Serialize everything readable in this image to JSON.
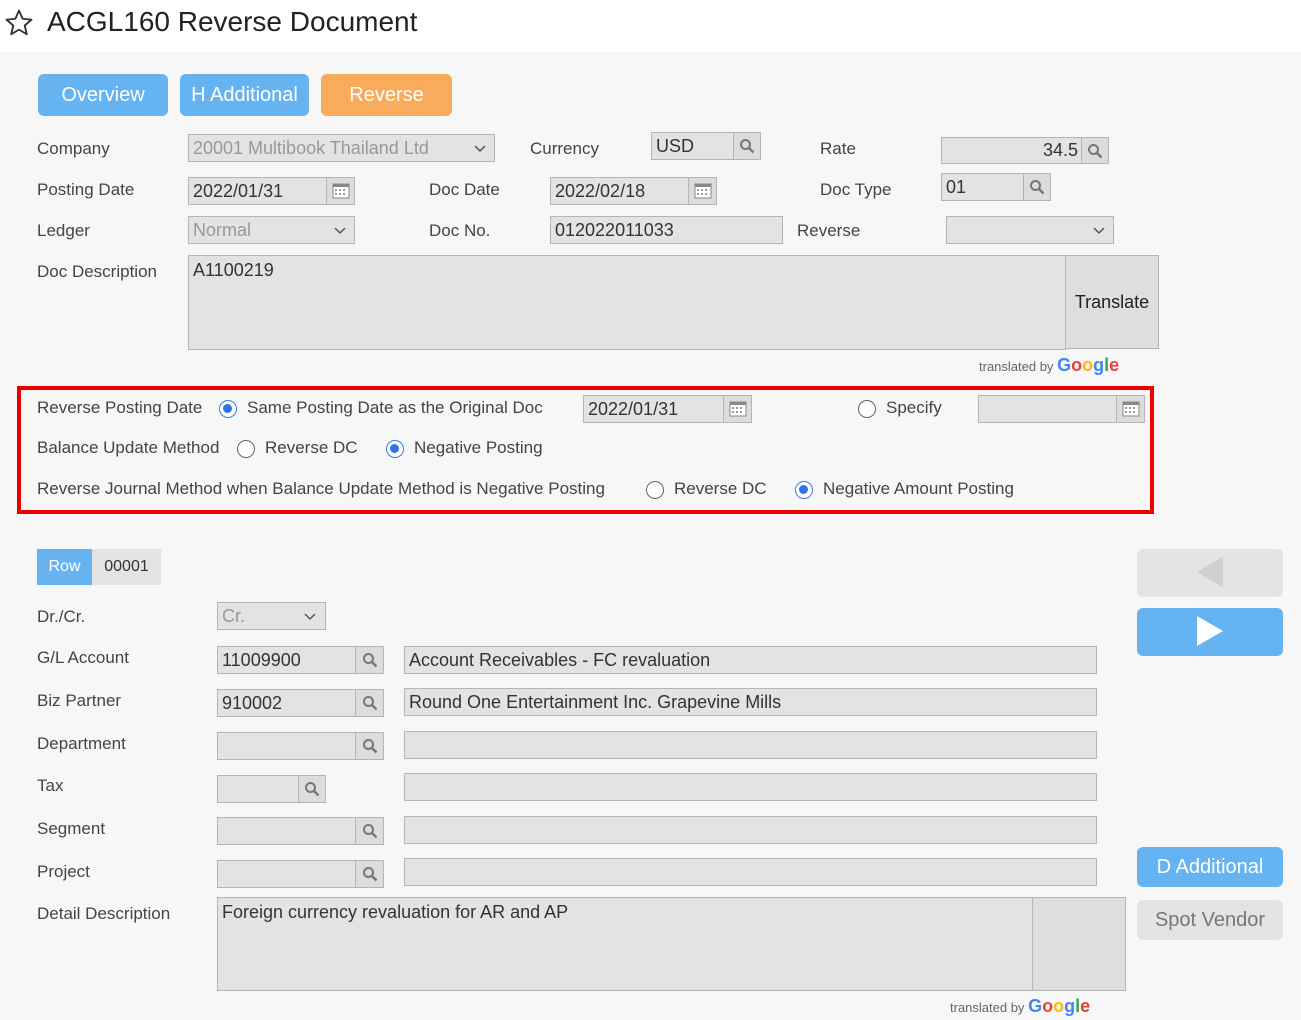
{
  "header": {
    "title": "ACGL160 Reverse Document",
    "icon": "star-icon"
  },
  "tabs": {
    "overview": "Overview",
    "h_additional": "H Additional",
    "reverse": "Reverse"
  },
  "doc": {
    "company_label": "Company",
    "company_value": "20001 Multibook Thailand Ltd",
    "currency_label": "Currency",
    "currency_value": "USD",
    "rate_label": "Rate",
    "rate_value": "34.5",
    "posting_date_label": "Posting Date",
    "posting_date_value": "2022/01/31",
    "doc_date_label": "Doc Date",
    "doc_date_value": "2022/02/18",
    "doc_type_label": "Doc Type",
    "doc_type_value": "01",
    "ledger_label": "Ledger",
    "ledger_value": "Normal",
    "doc_no_label": "Doc No.",
    "doc_no_value": "012022011033",
    "reverse_label": "Reverse",
    "reverse_value": "",
    "desc_label": "Doc Description",
    "desc_value": "A1100219",
    "translate_label": "Translate",
    "translated_by": "translated by"
  },
  "reverse_opts": {
    "posting_date_label": "Reverse Posting Date",
    "same_date_label": "Same Posting Date as the Original Doc",
    "same_date_value": "2022/01/31",
    "specify_label": "Specify",
    "specify_value": "",
    "balance_label": "Balance Update Method",
    "balance_reverse_dc": "Reverse DC",
    "balance_negative": "Negative Posting",
    "journal_label": "Reverse Journal Method when Balance Update Method is Negative Posting",
    "journal_reverse_dc": "Reverse DC",
    "journal_negative": "Negative Amount Posting"
  },
  "row": {
    "row_label": "Row",
    "row_value": "00001",
    "drcr_label": "Dr./Cr.",
    "drcr_value": "Cr.",
    "gl_label": "G/L Account",
    "gl_value": "11009900",
    "gl_name": "Account Receivables - FC revaluation",
    "bp_label": "Biz Partner",
    "bp_value": "910002",
    "bp_name": "Round One Entertainment Inc. Grapevine Mills",
    "dept_label": "Department",
    "dept_value": "",
    "dept_name": "",
    "tax_label": "Tax",
    "tax_value": "",
    "tax_name": "",
    "segment_label": "Segment",
    "segment_value": "",
    "segment_name": "",
    "project_label": "Project",
    "project_value": "",
    "project_name": "",
    "detail_label": "Detail Description",
    "detail_value": "Foreign currency revaluation for AR and AP",
    "d_additional": "D Additional",
    "spot_vendor": "Spot Vendor",
    "translated_by": "translated by"
  },
  "colors": {
    "accent_blue": "#66b3f2",
    "accent_orange": "#f8ab5a",
    "highlight_red": "#ee0000"
  }
}
